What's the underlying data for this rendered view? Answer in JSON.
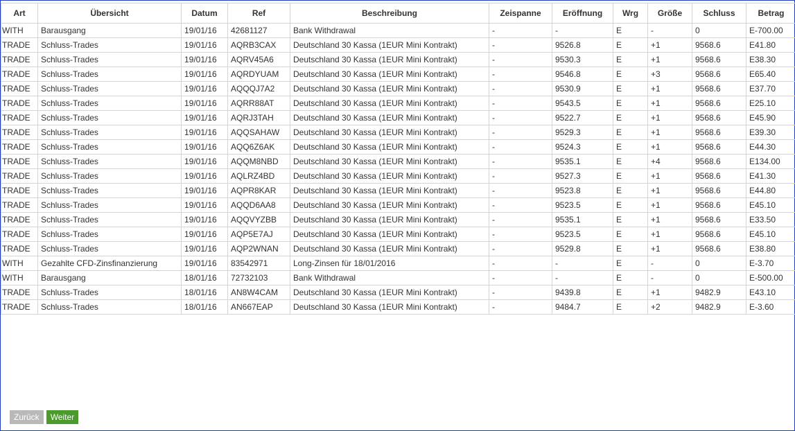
{
  "table": {
    "headers": [
      "Art",
      "Übersicht",
      "Datum",
      "Ref",
      "Beschreibung",
      "Zeispanne",
      "Eröffnung",
      "Wrg",
      "Größe",
      "Schluss",
      "Betrag"
    ],
    "rows": [
      [
        "WITH",
        "Barausgang",
        "19/01/16",
        "42681127",
        "Bank Withdrawal",
        "-",
        "-",
        "E",
        "-",
        "0",
        "E-700.00"
      ],
      [
        "TRADE",
        "Schluss-Trades",
        "19/01/16",
        "AQRB3CAX",
        "Deutschland 30 Kassa (1EUR Mini Kontrakt)",
        "-",
        "9526.8",
        "E",
        "+1",
        "9568.6",
        "E41.80"
      ],
      [
        "TRADE",
        "Schluss-Trades",
        "19/01/16",
        "AQRV45A6",
        "Deutschland 30 Kassa (1EUR Mini Kontrakt)",
        "-",
        "9530.3",
        "E",
        "+1",
        "9568.6",
        "E38.30"
      ],
      [
        "TRADE",
        "Schluss-Trades",
        "19/01/16",
        "AQRDYUAM",
        "Deutschland 30 Kassa (1EUR Mini Kontrakt)",
        "-",
        "9546.8",
        "E",
        "+3",
        "9568.6",
        "E65.40"
      ],
      [
        "TRADE",
        "Schluss-Trades",
        "19/01/16",
        "AQQQJ7A2",
        "Deutschland 30 Kassa (1EUR Mini Kontrakt)",
        "-",
        "9530.9",
        "E",
        "+1",
        "9568.6",
        "E37.70"
      ],
      [
        "TRADE",
        "Schluss-Trades",
        "19/01/16",
        "AQRR88AT",
        "Deutschland 30 Kassa (1EUR Mini Kontrakt)",
        "-",
        "9543.5",
        "E",
        "+1",
        "9568.6",
        "E25.10"
      ],
      [
        "TRADE",
        "Schluss-Trades",
        "19/01/16",
        "AQRJ3TAH",
        "Deutschland 30 Kassa (1EUR Mini Kontrakt)",
        "-",
        "9522.7",
        "E",
        "+1",
        "9568.6",
        "E45.90"
      ],
      [
        "TRADE",
        "Schluss-Trades",
        "19/01/16",
        "AQQSAHAW",
        "Deutschland 30 Kassa (1EUR Mini Kontrakt)",
        "-",
        "9529.3",
        "E",
        "+1",
        "9568.6",
        "E39.30"
      ],
      [
        "TRADE",
        "Schluss-Trades",
        "19/01/16",
        "AQQ6Z6AK",
        "Deutschland 30 Kassa (1EUR Mini Kontrakt)",
        "-",
        "9524.3",
        "E",
        "+1",
        "9568.6",
        "E44.30"
      ],
      [
        "TRADE",
        "Schluss-Trades",
        "19/01/16",
        "AQQM8NBD",
        "Deutschland 30 Kassa (1EUR Mini Kontrakt)",
        "-",
        "9535.1",
        "E",
        "+4",
        "9568.6",
        "E134.00"
      ],
      [
        "TRADE",
        "Schluss-Trades",
        "19/01/16",
        "AQLRZ4BD",
        "Deutschland 30 Kassa (1EUR Mini Kontrakt)",
        "-",
        "9527.3",
        "E",
        "+1",
        "9568.6",
        "E41.30"
      ],
      [
        "TRADE",
        "Schluss-Trades",
        "19/01/16",
        "AQPR8KAR",
        "Deutschland 30 Kassa (1EUR Mini Kontrakt)",
        "-",
        "9523.8",
        "E",
        "+1",
        "9568.6",
        "E44.80"
      ],
      [
        "TRADE",
        "Schluss-Trades",
        "19/01/16",
        "AQQD6AA8",
        "Deutschland 30 Kassa (1EUR Mini Kontrakt)",
        "-",
        "9523.5",
        "E",
        "+1",
        "9568.6",
        "E45.10"
      ],
      [
        "TRADE",
        "Schluss-Trades",
        "19/01/16",
        "AQQVYZBB",
        "Deutschland 30 Kassa (1EUR Mini Kontrakt)",
        "-",
        "9535.1",
        "E",
        "+1",
        "9568.6",
        "E33.50"
      ],
      [
        "TRADE",
        "Schluss-Trades",
        "19/01/16",
        "AQP5E7AJ",
        "Deutschland 30 Kassa (1EUR Mini Kontrakt)",
        "-",
        "9523.5",
        "E",
        "+1",
        "9568.6",
        "E45.10"
      ],
      [
        "TRADE",
        "Schluss-Trades",
        "19/01/16",
        "AQP2WNAN",
        "Deutschland 30 Kassa (1EUR Mini Kontrakt)",
        "-",
        "9529.8",
        "E",
        "+1",
        "9568.6",
        "E38.80"
      ],
      [
        "WITH",
        "Gezahlte CFD-Zinsfinanzierung",
        "19/01/16",
        "83542971",
        "Long-Zinsen für 18/01/2016",
        "-",
        "-",
        "E",
        "-",
        "0",
        "E-3.70"
      ],
      [
        "WITH",
        "Barausgang",
        "18/01/16",
        "72732103",
        "Bank Withdrawal",
        "-",
        "-",
        "E",
        "-",
        "0",
        "E-500.00"
      ],
      [
        "TRADE",
        "Schluss-Trades",
        "18/01/16",
        "AN8W4CAM",
        "Deutschland 30 Kassa (1EUR Mini Kontrakt)",
        "-",
        "9439.8",
        "E",
        "+1",
        "9482.9",
        "E43.10"
      ],
      [
        "TRADE",
        "Schluss-Trades",
        "18/01/16",
        "AN667EAP",
        "Deutschland 30 Kassa (1EUR Mini Kontrakt)",
        "-",
        "9484.7",
        "E",
        "+2",
        "9482.9",
        "E-3.60"
      ]
    ]
  },
  "pager": {
    "back_label": "Zurück",
    "next_label": "Weiter"
  }
}
